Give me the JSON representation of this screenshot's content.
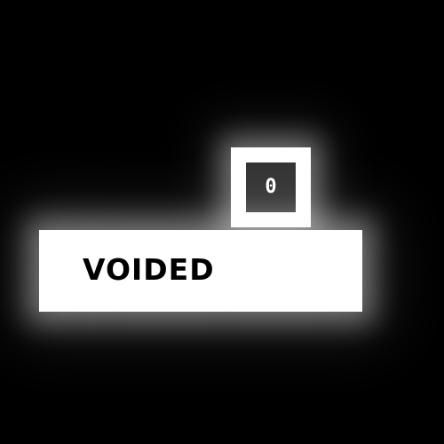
{
  "game": {
    "title": "VOIDED",
    "score": "0",
    "colors": {
      "background": "#000000",
      "panel": "#ffffff",
      "score_inner": "#333333",
      "title_text": "#000000"
    }
  }
}
